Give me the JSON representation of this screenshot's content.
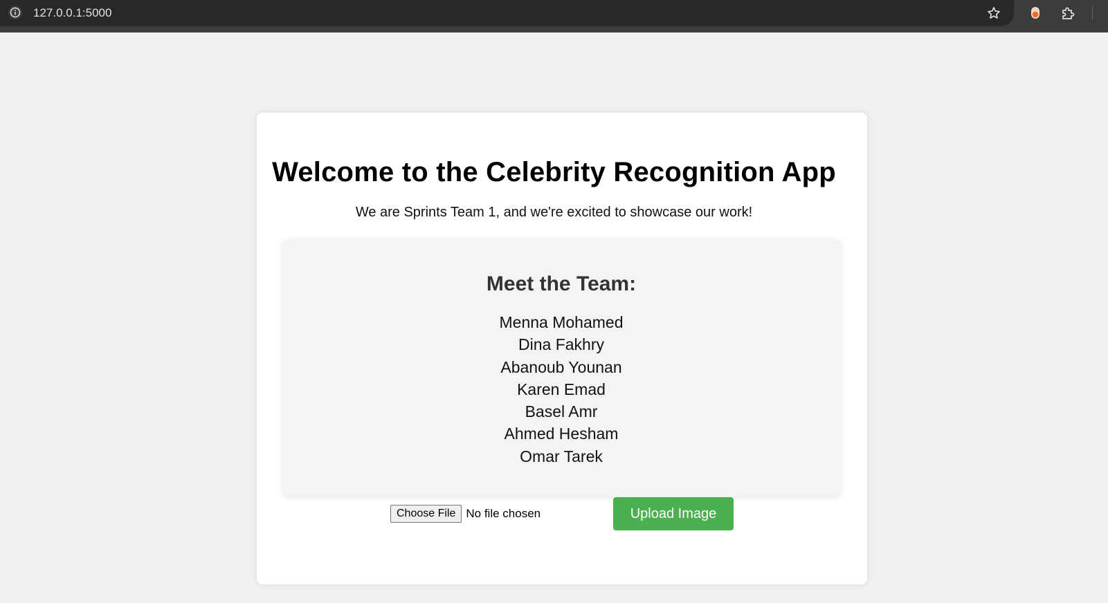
{
  "browser": {
    "url": "127.0.0.1:5000",
    "icons": [
      "info-icon",
      "star-icon",
      "extension-icon",
      "puzzle-icon"
    ]
  },
  "page": {
    "title": "Welcome to the Celebrity Recognition App",
    "subtitle": "We are Sprints Team 1, and we're excited to showcase our work!",
    "team": {
      "heading": "Meet the Team:",
      "members": [
        "Menna Mohamed",
        "Dina Fakhry",
        "Abanoub Younan",
        "Karen Emad",
        "Basel Amr",
        "Ahmed Hesham",
        "Omar Tarek"
      ]
    },
    "upload": {
      "choose_label": "Choose File",
      "file_status": "No file chosen",
      "button_label": "Upload Image"
    }
  },
  "colors": {
    "page_bg": "#f0f0f0",
    "card_bg": "#ffffff",
    "team_box_bg": "#f4f4f4",
    "upload_button": "#4caf50",
    "browser_bar": "#282828"
  }
}
